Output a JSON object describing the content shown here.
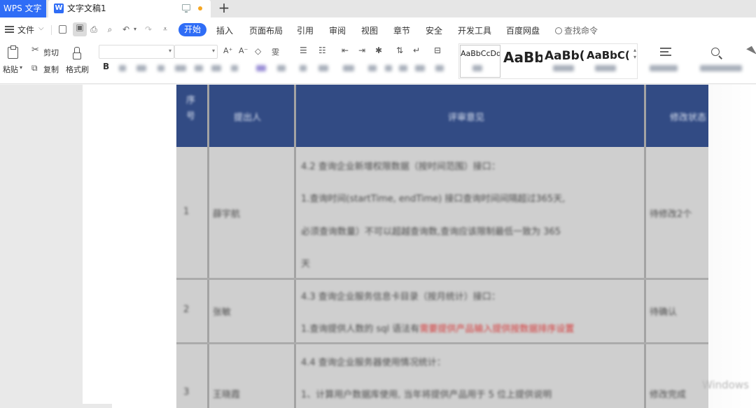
{
  "titlebar": {
    "app_tab": "WPS 文字",
    "doc_tab": "文字文稿1",
    "new_tab_symbol": "+",
    "unsaved_dot_color": "#f5a623"
  },
  "menubar": {
    "file_label": "文件",
    "active_tab": "开始",
    "tabs": [
      "插入",
      "页面布局",
      "引用",
      "审阅",
      "视图",
      "章节",
      "安全",
      "开发工具",
      "百度网盘"
    ],
    "search_label": "查找命令",
    "accent_color": "#2f6df6"
  },
  "ribbon": {
    "paste": "粘贴",
    "cut": "剪切",
    "copy": "复制",
    "format_painter": "格式刷",
    "bold": "B",
    "font_name": "",
    "font_size": "",
    "styles": [
      "AaBbCcDd",
      "AaBb",
      "AaBb(",
      "AaBbC("
    ]
  },
  "table": {
    "header_color": "#324b84",
    "columns": [
      "序号",
      "提出人",
      "评审意见",
      "修改状态"
    ],
    "rows": [
      {
        "no": "1",
        "person": "薛宇航",
        "lines": [
          "4.2 查询企业新增权限数据（按时间范围）接口：",
          "1.查询时间(startTime, endTime) 接口查询时间间隔超过365天,",
          "必须查询数量）不可以超越查询数,查询应该限制最低一致为 365",
          "天"
        ],
        "status": "待修改2个"
      },
      {
        "no": "2",
        "person": "张敏",
        "lines": [
          "4.3 查询企业服务信息卡目录（按月统计）接口：",
          "1.查询提供人数的 sql 语法有"
        ],
        "red_text": "需要提供产品输入提供按数据排序设置",
        "status": "待确认"
      },
      {
        "no": "3",
        "person": "王晓霞",
        "lines": [
          "4.4 查询企业服务器使用情况统计：",
          "1、计算用户数据库使用, 当年将提供产品用于 5 位上提供说明"
        ],
        "status": "修改完成"
      }
    ]
  },
  "watermark": "Windows"
}
